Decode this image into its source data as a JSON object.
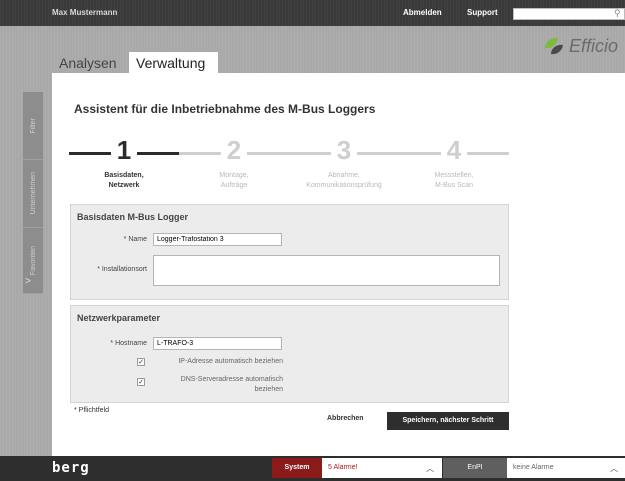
{
  "topbar": {
    "user": "Max Mustermann",
    "logout": "Abmelden",
    "support": "Support",
    "search_placeholder": ""
  },
  "brand": {
    "logo_text": "Efficio",
    "footer_brand": "berg"
  },
  "sidebar": {
    "items": [
      {
        "label": "Filter"
      },
      {
        "label": "Unternehmen"
      },
      {
        "label": "Favoriten"
      }
    ],
    "arrow": ">"
  },
  "tabs": [
    {
      "label": "Analysen"
    },
    {
      "label": "Verwaltung"
    }
  ],
  "wizard": {
    "title": "Assistent für die Inbetriebnahme des M-Bus Loggers",
    "steps": [
      {
        "num": "1",
        "label_line1": "Basisdaten,",
        "label_line2": "Netzwerk"
      },
      {
        "num": "2",
        "label_line1": "Montage,",
        "label_line2": "Aufträge"
      },
      {
        "num": "3",
        "label_line1": "Abnahme,",
        "label_line2": "Kommunikationsprüfung"
      },
      {
        "num": "4",
        "label_line1": "Messstellen,",
        "label_line2": "M-Bus Scan"
      }
    ]
  },
  "basis": {
    "title": "Basisdaten M-Bus Logger",
    "name_label": "* Name",
    "name_value": "Logger-Trafostation 3",
    "install_label": "* Installationsort",
    "install_value": ""
  },
  "network": {
    "title": "Netzwerkparameter",
    "hostname_label": "* Hostname",
    "hostname_value": "L-TRAFO-3",
    "ip_label": "IP-Adresse automatisch beziehen",
    "dns_label_line1": "DNS-Serveradresse automatisch",
    "dns_label_line2": "beziehen",
    "check_mark": "✓"
  },
  "footer": {
    "required_note": "* Pflichtfeld",
    "cancel": "Abbrechen",
    "save_next": "Speichern, nächster Schritt"
  },
  "statusbar": {
    "system_label": "System",
    "system_value": "5 Alarme!",
    "enpi_label": "EnPI",
    "enpi_value": "keine Alarme"
  }
}
